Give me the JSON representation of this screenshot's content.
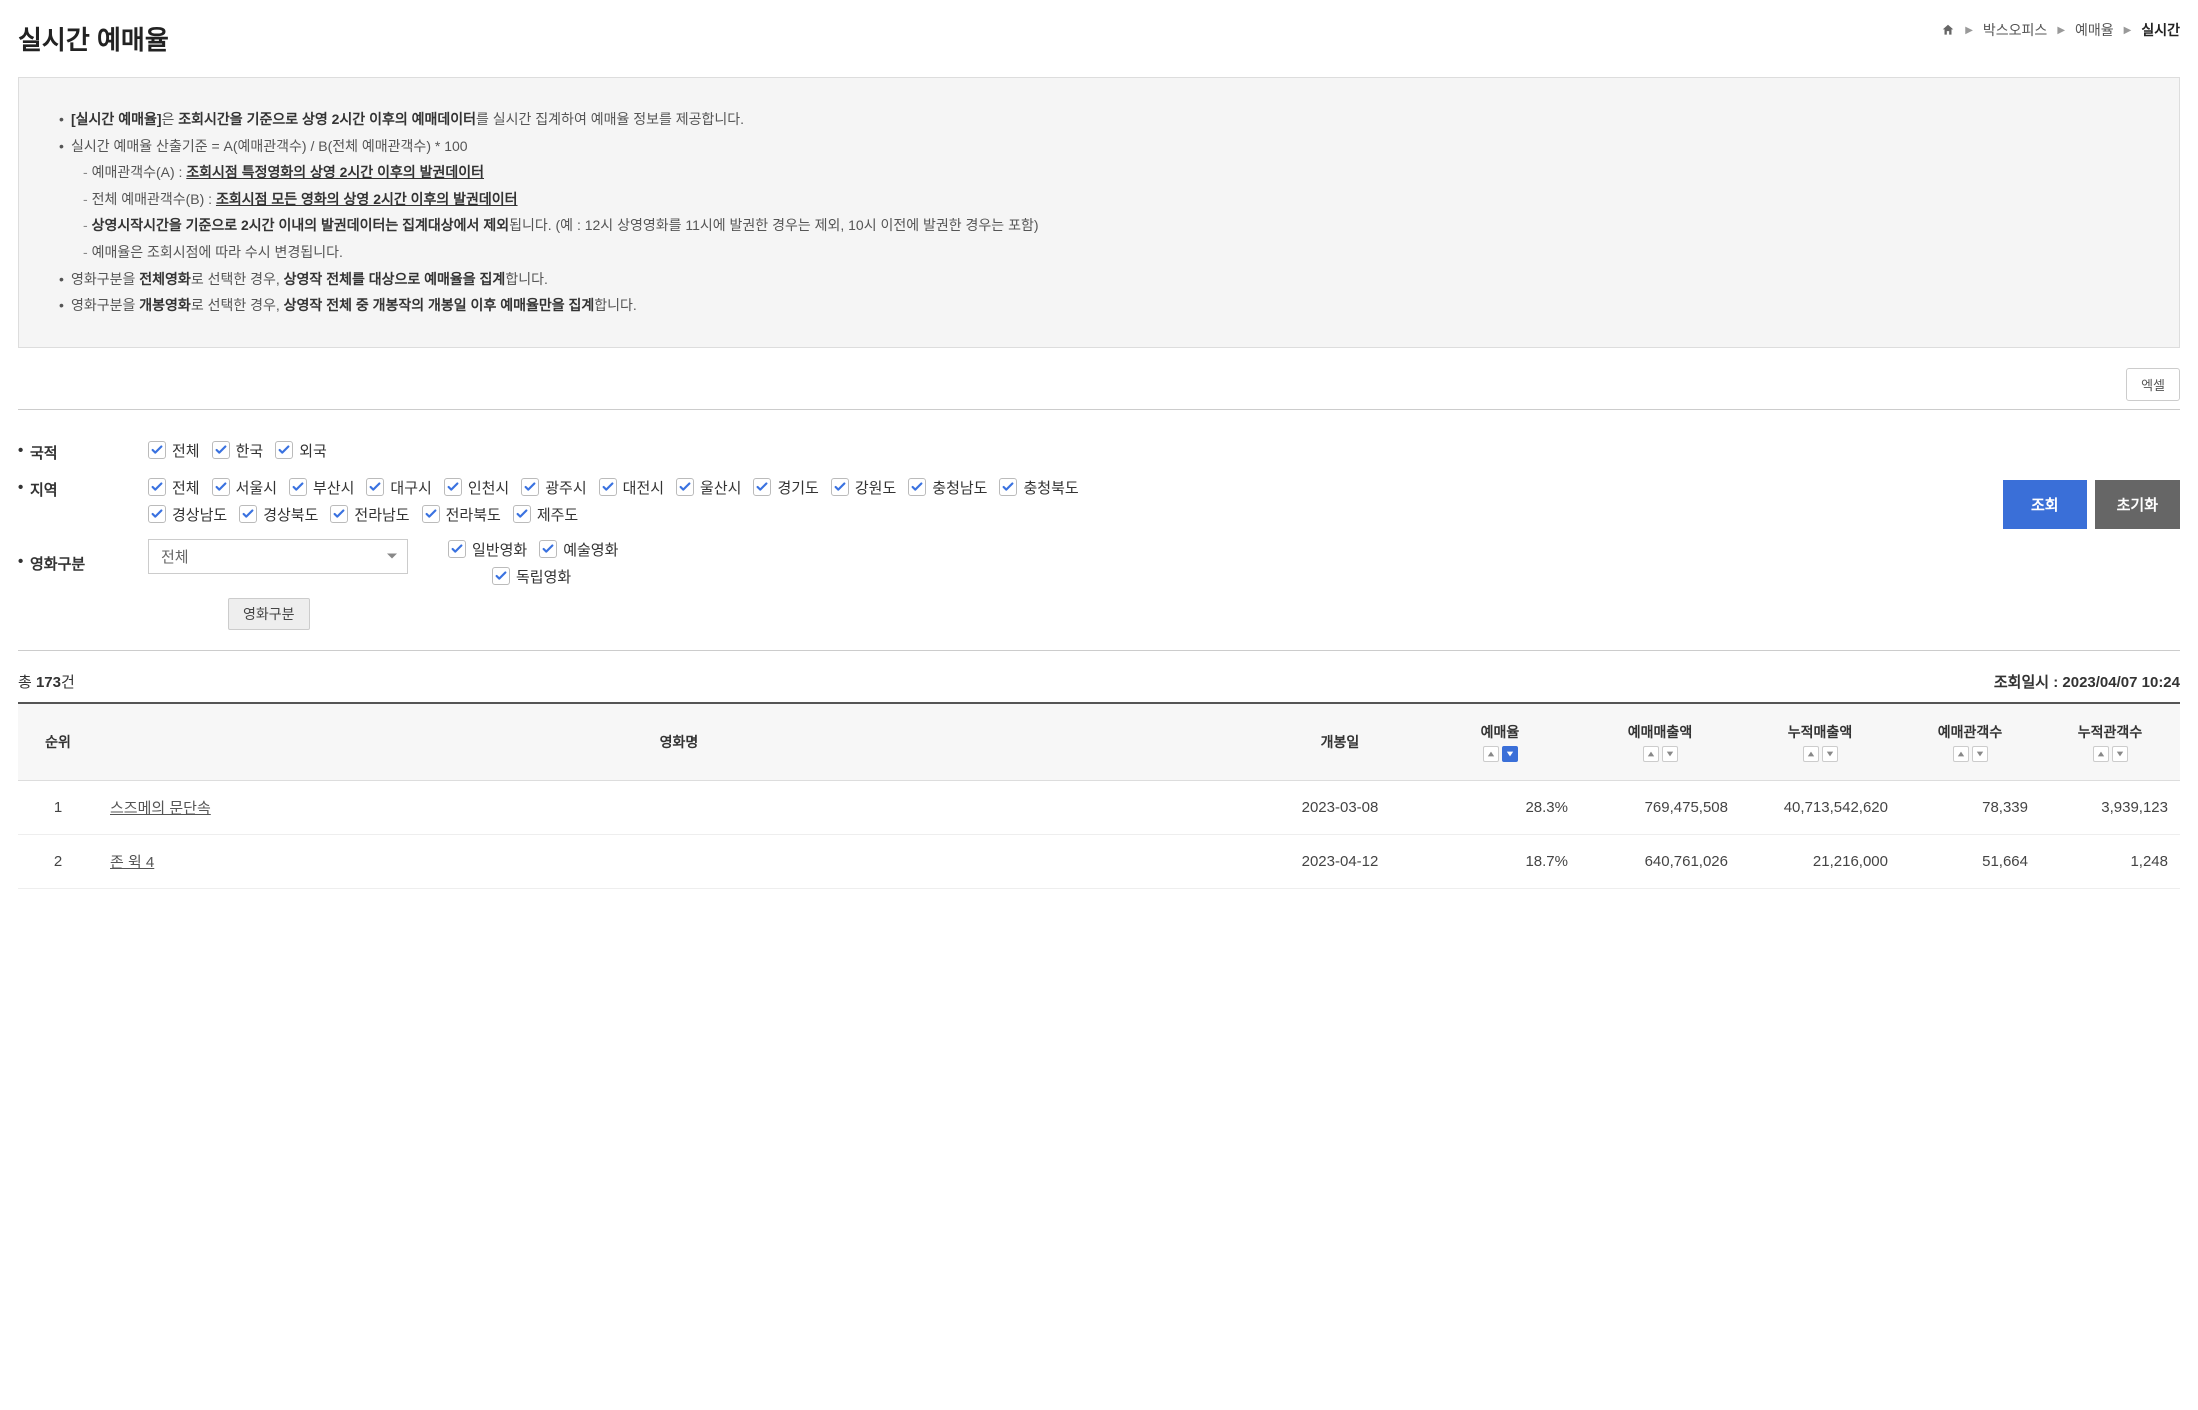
{
  "page_title": "실시간 예매율",
  "breadcrumb": {
    "b1": "박스오피스",
    "b2": "예매율",
    "current": "실시간"
  },
  "info": {
    "l1a": "[실시간 예매율]",
    "l1b": "은 ",
    "l1c": "조회시간을 기준으로 상영 2시간 이후의 예매데이터",
    "l1d": "를 실시간 집계하여 예매율 정보를 제공합니다.",
    "l2": "실시간 예매율 산출기준 = A(예매관객수) / B(전체 예매관객수) * 100",
    "l2s1a": "예매관객수(A) : ",
    "l2s1b": "조회시점 특정영화의 상영 2시간 이후의 발권데이터",
    "l2s2a": "전체 예매관객수(B) : ",
    "l2s2b": "조회시점 모든 영화의 상영 2시간 이후의 발권데이터",
    "l2s3a": "상영시작시간을 기준으로 2시간 이내의 발권데이터는 집계대상에서 제외",
    "l2s3b": "됩니다. (예 : 12시 상영영화를 11시에 발권한 경우는 제외, 10시 이전에 발권한 경우는 포함)",
    "l2s4": "예매율은 조회시점에 따라 수시 변경됩니다.",
    "l3a": "영화구분을 ",
    "l3b": "전체영화",
    "l3c": "로 선택한 경우, ",
    "l3d": "상영작 전체를 대상으로 예매율을 집계",
    "l3e": "합니다.",
    "l4a": "영화구분을 ",
    "l4b": "개봉영화",
    "l4c": "로 선택한 경우, ",
    "l4d": "상영작 전체 중 개봉작의 개봉일 이후 예매율만을 집계",
    "l4e": "합니다."
  },
  "buttons": {
    "excel": "엑셀",
    "search": "조회",
    "reset": "초기화"
  },
  "filters": {
    "nationality_label": "국적",
    "nationality_opts": {
      "all": "전체",
      "kr": "한국",
      "fr": "외국"
    },
    "region_label": "지역",
    "region_opts": [
      "전체",
      "서울시",
      "부산시",
      "대구시",
      "인천시",
      "광주시",
      "대전시",
      "울산시",
      "경기도",
      "강원도",
      "충청남도",
      "충청북도",
      "경상남도",
      "경상북도",
      "전라남도",
      "전라북도",
      "제주도"
    ],
    "category_label": "영화구분",
    "category_select": "전체",
    "category_sub": {
      "general": "일반영화",
      "art": "예술영화",
      "indie": "독립영화"
    },
    "tooltip": "영화구분"
  },
  "summary": {
    "total_prefix": "총 ",
    "total_count": "173",
    "total_suffix": "건",
    "query_time_label": "조회일시 : ",
    "query_time": "2023/04/07 10:24"
  },
  "table": {
    "headers": {
      "rank": "순위",
      "title": "영화명",
      "open": "개봉일",
      "rate": "예매율",
      "sales": "예매매출액",
      "cum_sales": "누적매출액",
      "aud": "예매관객수",
      "cum_aud": "누적관객수"
    },
    "rows": [
      {
        "rank": "1",
        "title": "스즈메의 문단속",
        "open": "2023-03-08",
        "rate": "28.3%",
        "sales": "769,475,508",
        "cum_sales": "40,713,542,620",
        "aud": "78,339",
        "cum_aud": "3,939,123"
      },
      {
        "rank": "2",
        "title": "존 윅 4",
        "open": "2023-04-12",
        "rate": "18.7%",
        "sales": "640,761,026",
        "cum_sales": "21,216,000",
        "aud": "51,664",
        "cum_aud": "1,248"
      }
    ]
  }
}
